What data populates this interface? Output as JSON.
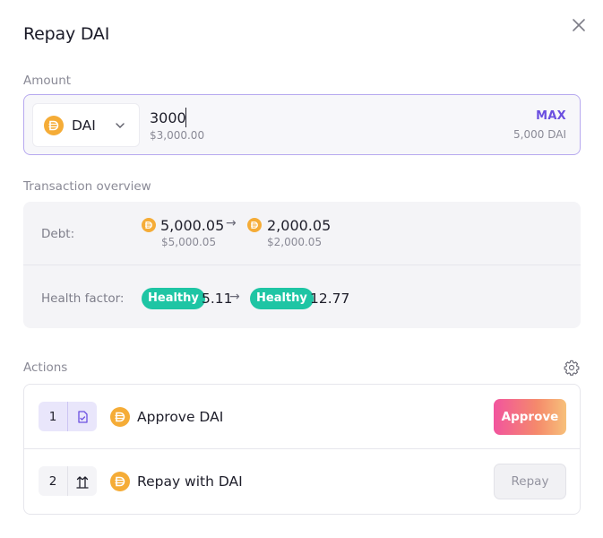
{
  "modal": {
    "title": "Repay DAI"
  },
  "amount": {
    "label": "Amount",
    "token": "DAI",
    "value": "3000",
    "usd": "$3,000.00",
    "max_label": "MAX",
    "balance": "5,000 DAI"
  },
  "overview": {
    "label": "Transaction overview",
    "debt": {
      "label": "Debt:",
      "from": "5,000.05",
      "from_usd": "$5,000.05",
      "to": "2,000.05",
      "to_usd": "$2,000.05",
      "arrow": "→"
    },
    "health": {
      "label": "Health factor:",
      "from_badge": "Healthy",
      "from": "5.11",
      "to_badge": "Healthy",
      "to": "12.77",
      "arrow": "→"
    }
  },
  "actions": {
    "label": "Actions",
    "steps": [
      {
        "number": "1",
        "label": "Approve DAI",
        "button": "Approve"
      },
      {
        "number": "2",
        "label": "Repay with DAI",
        "button": "Repay"
      }
    ]
  },
  "colors": {
    "accent": "#6b4fe0",
    "healthy": "#1ec5a4",
    "dai": "#f5ac37"
  },
  "icons": {
    "close": "close-icon",
    "token": "dai-coin-icon",
    "dropdown": "chevron-down-icon",
    "settings": "gear-icon",
    "approve_step": "document-sign-icon",
    "repay_step": "transfer-arrows-icon"
  }
}
